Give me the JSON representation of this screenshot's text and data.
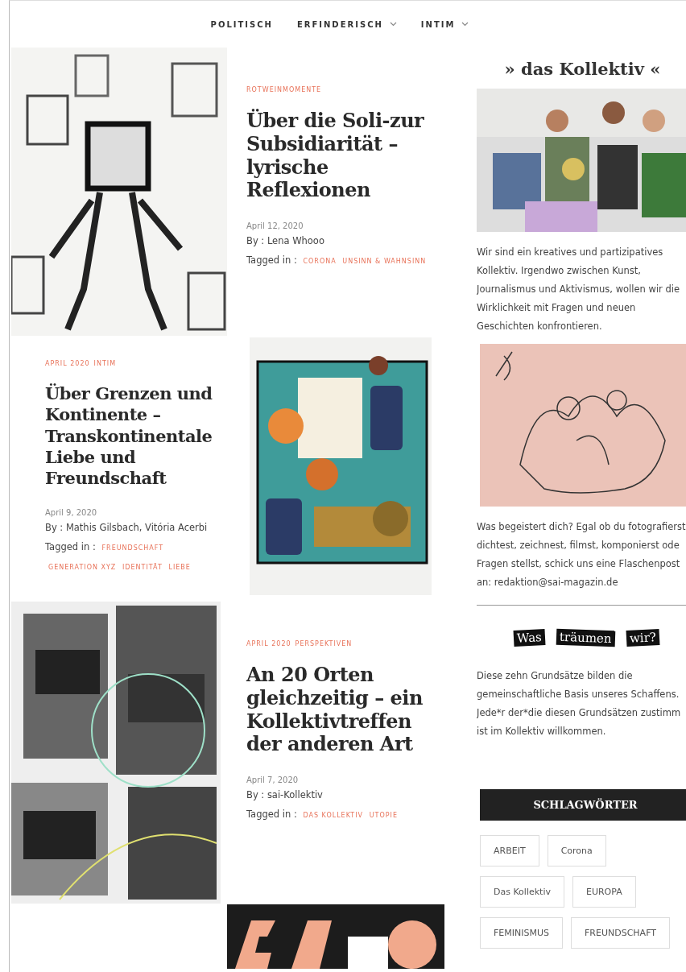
{
  "nav": [
    {
      "label": "POLITISCH",
      "dropdown": false
    },
    {
      "label": "ERFINDERISCH",
      "dropdown": true
    },
    {
      "label": "INTIM",
      "dropdown": true
    }
  ],
  "grid": [
    {
      "kind": "picture"
    },
    {
      "kind": "post",
      "categories": [
        "ROTWEINMOMENTE"
      ],
      "title": "Über die Soli-zur Subsidiarität – lyrische Reflexionen",
      "date": "April 12, 2020",
      "author_label": "By :",
      "author": "Lena Whooo",
      "tags_label": "Tagged in :",
      "tags": [
        "CORONA",
        "UNSINN & WAHNSINN"
      ]
    },
    {
      "kind": "post",
      "categories": [
        "APRIL 2020",
        "INTIM"
      ],
      "title": "Über Grenzen und Kontinente – Transkontinentale Liebe und Freundschaft",
      "date": "April 9, 2020",
      "author_label": "By :",
      "author": "Mathis Gilsbach, Vitória Acerbi",
      "tags_label": "Tagged in :",
      "tags": [
        "FREUNDSCHAFT",
        "GENERATION XYZ",
        "IDENTITÄT",
        "LIEBE"
      ]
    },
    {
      "kind": "picture"
    },
    {
      "kind": "picture"
    },
    {
      "kind": "post",
      "categories": [
        "APRIL 2020",
        "PERSPEKTIVEN"
      ],
      "title": "An 20 Orten gleichzeitig – ein Kollektivtreffen der anderen Art",
      "date": "April 7, 2020",
      "author_label": "By :",
      "author": "sai-Kollektiv",
      "tags_label": "Tagged in :",
      "tags": [
        "DAS KOLLEKTIV",
        "UTOPIE"
      ]
    },
    {
      "kind": "picture"
    }
  ],
  "sidebar": {
    "title": "» das Kollektiv «",
    "intro": "Wir sind ein kreatives und partizipatives Kollektiv. Irgendwo zwischen Kunst, Journalismus und Aktivismus, wollen wir die Wirklichkeit  mit Fragen und neuen Geschichten konfrontieren.",
    "call": "Was begeistert dich? Egal ob du fotografierst dichtest, zeichnest, filmst, komponierst ode Fragen stellst, schick uns eine Flaschenpost an: redaktion@sai-magazin.de",
    "heading_words": [
      "Was",
      "träumen",
      "wir?"
    ],
    "principles": "Diese zehn Grundsätze bilden die gemeinschaftliche Basis unseres Schaffens. Jede*r der*die diesen Grundsätzen zustimm ist im Kollektiv willkommen.",
    "tags_title": "SCHLAGWÖRTER",
    "tags": [
      "ARBEIT",
      "Corona",
      "Das Kollektiv",
      "EUROPA",
      "FEMINISMUS",
      "FREUNDSCHAFT"
    ]
  }
}
